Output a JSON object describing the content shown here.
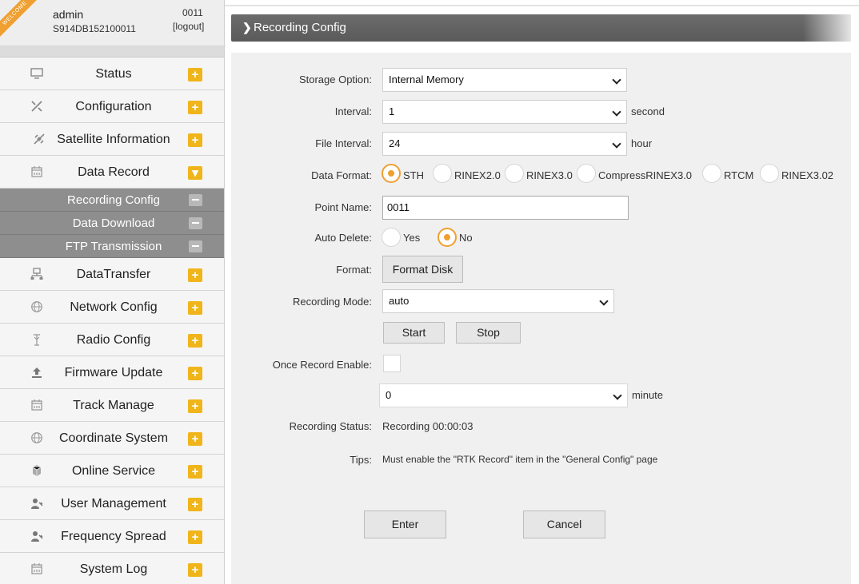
{
  "sidebar": {
    "ribbon": "WELCOME",
    "user": "admin",
    "serial": "S914DB152100011",
    "point": "0011",
    "logout": "[logout]",
    "items": [
      {
        "label": "Status",
        "icon": "monitor-icon",
        "toggle": "+"
      },
      {
        "label": "Configuration",
        "icon": "tools-icon",
        "toggle": "+"
      },
      {
        "label": "Satellite Information",
        "icon": "satellite-icon",
        "toggle": "+"
      },
      {
        "label": "Data Record",
        "icon": "calendar-icon",
        "toggle": "▾"
      },
      {
        "label": "DataTransfer",
        "icon": "network-icon",
        "toggle": "+"
      },
      {
        "label": "Network Config",
        "icon": "globe-icon",
        "toggle": "+"
      },
      {
        "label": "Radio Config",
        "icon": "antenna-icon",
        "toggle": "+"
      },
      {
        "label": "Firmware Update",
        "icon": "upload-icon",
        "toggle": "+"
      },
      {
        "label": "Track Manage",
        "icon": "calendar-icon",
        "toggle": "+"
      },
      {
        "label": "Coordinate System",
        "icon": "globe-icon",
        "toggle": "+"
      },
      {
        "label": "Online Service",
        "icon": "cloud-icon",
        "toggle": "+"
      },
      {
        "label": "User Management",
        "icon": "users-icon",
        "toggle": "+"
      },
      {
        "label": "Frequency Spread",
        "icon": "users-icon",
        "toggle": "+"
      },
      {
        "label": "System Log",
        "icon": "calendar-icon",
        "toggle": "+"
      }
    ],
    "subitems": [
      {
        "label": "Recording Config"
      },
      {
        "label": "Data Download"
      },
      {
        "label": "FTP Transmission"
      }
    ]
  },
  "header": {
    "title": "Recording Config"
  },
  "form": {
    "storage": {
      "label": "Storage Option:",
      "value": "Internal Memory"
    },
    "interval": {
      "label": "Interval:",
      "value": "1",
      "unit": "second"
    },
    "file_interval": {
      "label": "File Interval:",
      "value": "24",
      "unit": "hour"
    },
    "data_format": {
      "label": "Data Format:",
      "options": [
        "STH",
        "RINEX2.0",
        "RINEX3.0",
        "CompressRINEX3.0",
        "RTCM",
        "RINEX3.02"
      ],
      "selected": "STH"
    },
    "point_name": {
      "label": "Point Name:",
      "value": "0011"
    },
    "auto_delete": {
      "label": "Auto Delete:",
      "options": [
        "Yes",
        "No"
      ],
      "selected": "No"
    },
    "format": {
      "label": "Format:",
      "button": "Format Disk"
    },
    "recording_mode": {
      "label": "Recording Mode:",
      "value": "auto"
    },
    "start_button": "Start",
    "stop_button": "Stop",
    "once_record": {
      "label": "Once Record Enable:",
      "checked": false,
      "value": "0",
      "unit": "minute"
    },
    "recording_status": {
      "label": "Recording Status:",
      "value": "Recording 00:00:03"
    },
    "tips": {
      "label": "Tips:",
      "value": "Must enable the \"RTK Record\" item in the \"General Config\" page"
    },
    "enter_button": "Enter",
    "cancel_button": "Cancel"
  },
  "colors": {
    "accent": "#f0b51a",
    "radio_accent": "#f0a030",
    "submenu_bg": "#8e8e8e",
    "titlebar_bg": "#5f5f5f"
  }
}
